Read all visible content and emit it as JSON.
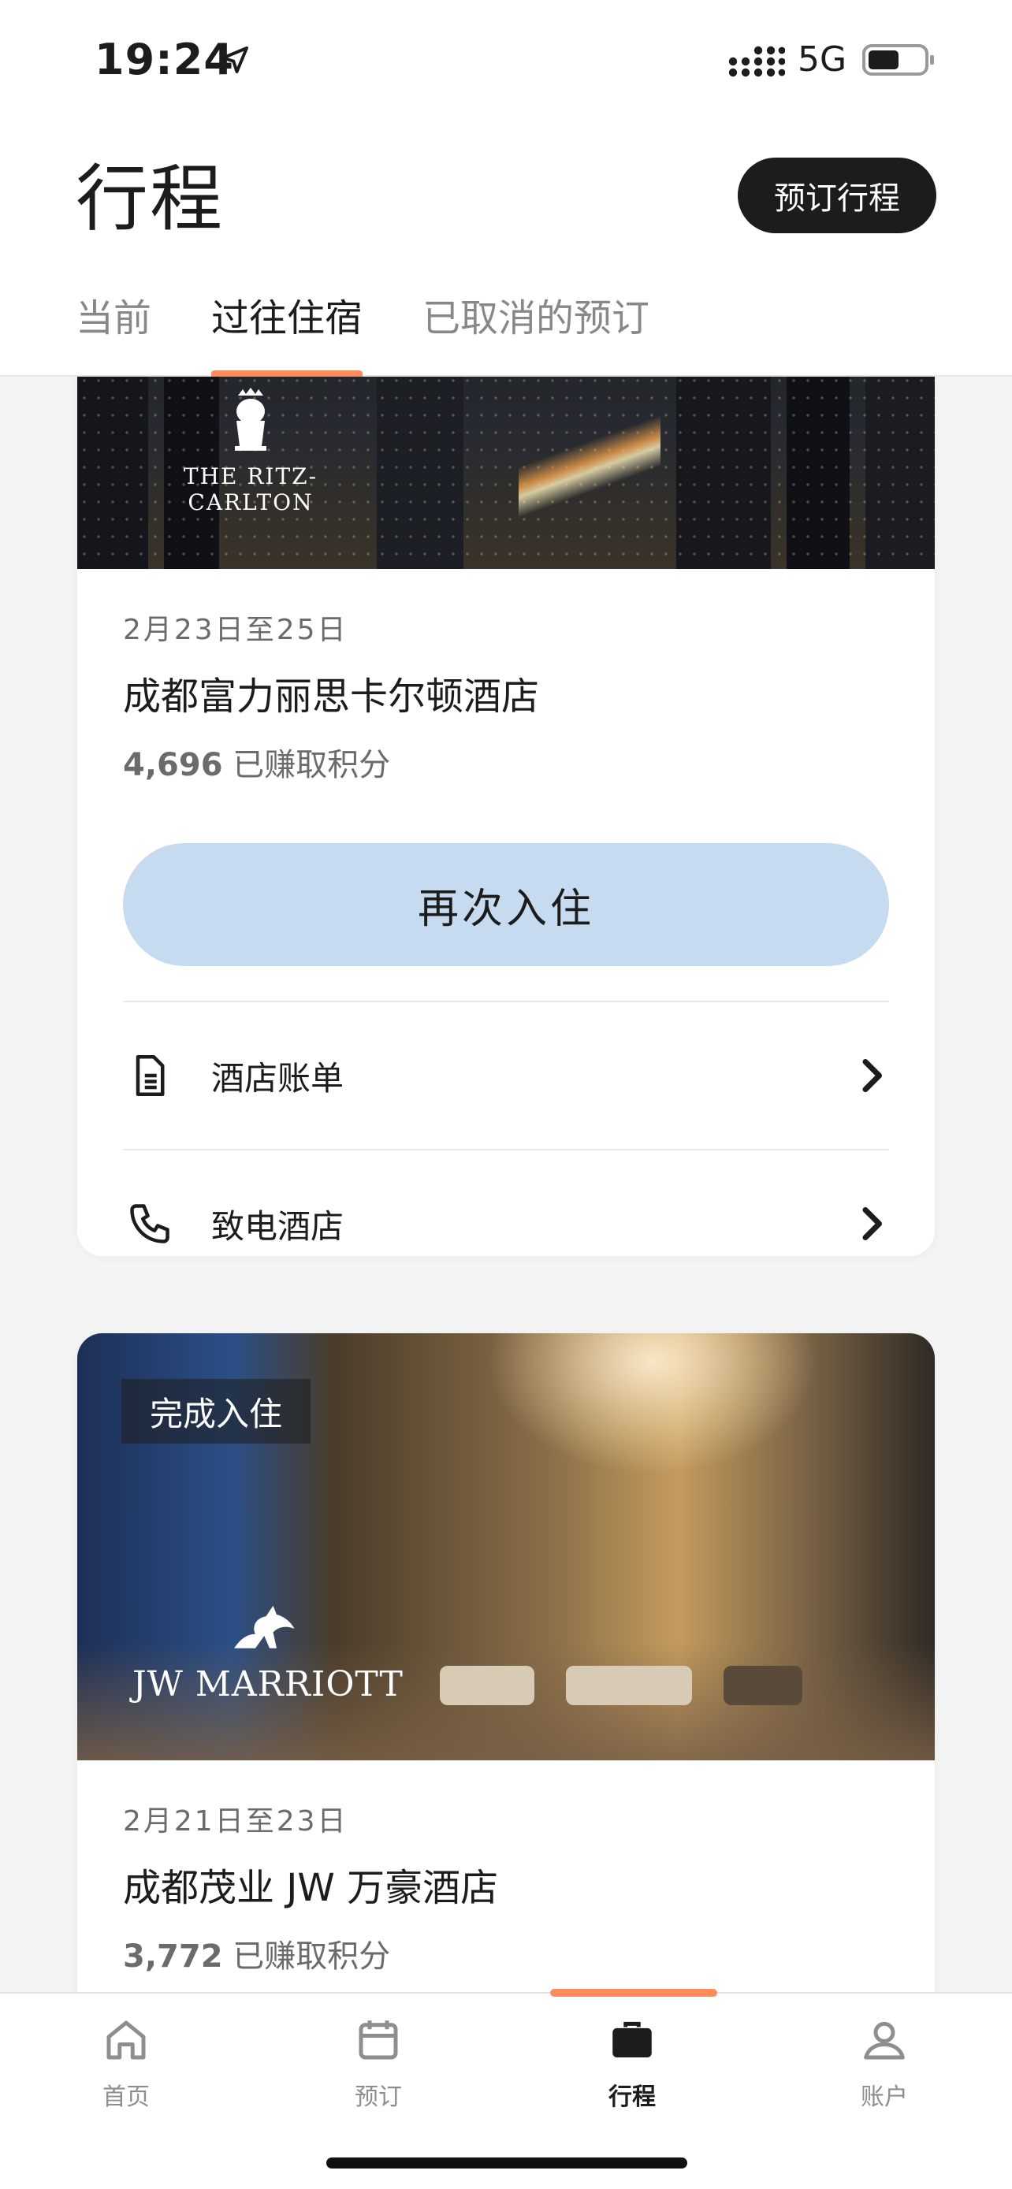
{
  "status_bar": {
    "time": "19:24",
    "network": "5G"
  },
  "header": {
    "title": "行程",
    "book_button": "预订行程"
  },
  "tabs": [
    {
      "label": "当前",
      "active": false
    },
    {
      "label": "过往住宿",
      "active": true
    },
    {
      "label": "已取消的预订",
      "active": false
    }
  ],
  "trips": [
    {
      "brand": "THE RITZ-CARLTON",
      "dates": "2月23日至25日",
      "hotel": "成都富力丽思卡尔顿酒店",
      "points_value": "4,696",
      "points_label": "已赚取积分",
      "rebook_label": "再次入住",
      "actions": [
        {
          "label": "酒店账单",
          "icon": "document-icon"
        },
        {
          "label": "致电酒店",
          "icon": "phone-icon"
        }
      ]
    },
    {
      "brand": "JW MARRIOTT",
      "badge": "完成入住",
      "dates": "2月21日至23日",
      "hotel": "成都茂业 JW 万豪酒店",
      "points_value": "3,772",
      "points_label": "已赚取积分"
    }
  ],
  "bottom_nav": [
    {
      "label": "首页",
      "icon": "home-icon",
      "active": false
    },
    {
      "label": "预订",
      "icon": "calendar-icon",
      "active": false
    },
    {
      "label": "行程",
      "icon": "briefcase-icon",
      "active": true
    },
    {
      "label": "账户",
      "icon": "account-icon",
      "active": false
    }
  ],
  "colors": {
    "accent": "#ff8c5a",
    "rebook_button": "#c7dbf0",
    "dark": "#1c1c1c"
  }
}
